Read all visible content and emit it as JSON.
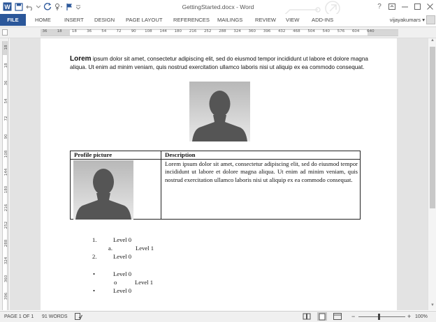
{
  "window": {
    "title": "GettingStarted.docx - Word"
  },
  "ribbon": {
    "file_label": "FILE",
    "tabs": [
      "HOME",
      "INSERT",
      "DESIGN",
      "PAGE LAYOUT",
      "REFERENCES",
      "MAILINGS",
      "REVIEW",
      "VIEW",
      "ADD-INS"
    ],
    "user": "vijayakumars"
  },
  "ruler": {
    "h_labels": [
      "36",
      "18",
      "18",
      "36",
      "54",
      "72",
      "90",
      "108",
      "144",
      "180",
      "216",
      "252",
      "288",
      "324",
      "360",
      "396",
      "432",
      "468",
      "504",
      "540",
      "576",
      "604",
      "640"
    ],
    "v_labels": [
      "18",
      "18",
      "36",
      "54",
      "72",
      "90",
      "108",
      "144",
      "180",
      "216",
      "252",
      "288",
      "324",
      "360",
      "396"
    ]
  },
  "document": {
    "intro_bold": "Lorem",
    "intro_rest": "ipsum dolor sit amet, consectetur adipiscing elit, sed do eiusmod tempor incididunt ut labore et dolore magna aliqua. Ut enim ad minim veniam, quis nostrud exercitation ullamco laboris nisi ut aliquip ex ea commodo consequat.",
    "table": {
      "headers": [
        "Profile picture",
        "Description"
      ],
      "description": "Lorem ipsum dolor sit amet, consectetur adipiscing elit, sed do eiusmod tempor incididunt ut labore et dolore magna aliqua. Ut enim ad minim veniam, quis nostrud exercitation ullamco laboris nisi ut aliquip ex ea commodo consequat."
    },
    "numbered_list": [
      {
        "marker": "1.",
        "text": "Level 0"
      },
      {
        "marker": "a.",
        "text": "Level 1"
      },
      {
        "marker": "2.",
        "text": "Level 0"
      }
    ],
    "bullet_list": [
      {
        "marker": "•",
        "text": "Level 0"
      },
      {
        "marker": "o",
        "text": "Level 1"
      },
      {
        "marker": "•",
        "text": "Level 0"
      }
    ]
  },
  "statusbar": {
    "page": "PAGE 1 OF 1",
    "words": "91 WORDS",
    "zoom": "100%"
  }
}
